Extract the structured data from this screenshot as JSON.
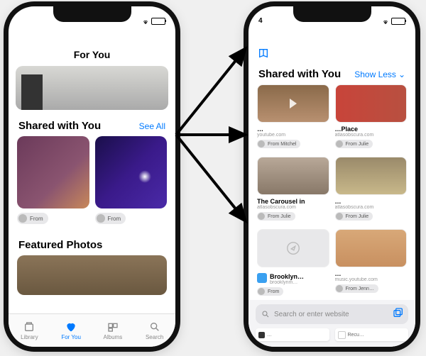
{
  "left": {
    "status_time": "",
    "header": "For You",
    "shared": {
      "title": "Shared with You",
      "action": "See All"
    },
    "card1_from": "From",
    "card2_from": "From",
    "featured": "Featured Photos",
    "tabs": [
      {
        "label": "Library"
      },
      {
        "label": "For You"
      },
      {
        "label": "Albums"
      },
      {
        "label": "Search"
      }
    ]
  },
  "right": {
    "status_time": "4",
    "shared": {
      "title": "Shared with You",
      "action": "Show Less"
    },
    "cards": [
      {
        "title": "…",
        "sub": "youtube.com",
        "from": "From Mitchel"
      },
      {
        "title": "…Place",
        "sub": "atlasobscura.com",
        "from": "From Julie"
      },
      {
        "title": "The Carousel in",
        "sub": "atlasobscura.com",
        "from": "From Julie"
      },
      {
        "title": "…",
        "sub": "atlasobscura.com",
        "from": "From Julie"
      },
      {
        "title": "Brooklyn…",
        "sub": "brooklynm…",
        "from": "From"
      },
      {
        "title": "…",
        "sub": "music.youtube.com",
        "from": "From Jenn…"
      }
    ],
    "search_placeholder": "Search or enter website",
    "mini_tabs": [
      {
        "label": "…"
      },
      {
        "label": "Recu…"
      }
    ]
  }
}
